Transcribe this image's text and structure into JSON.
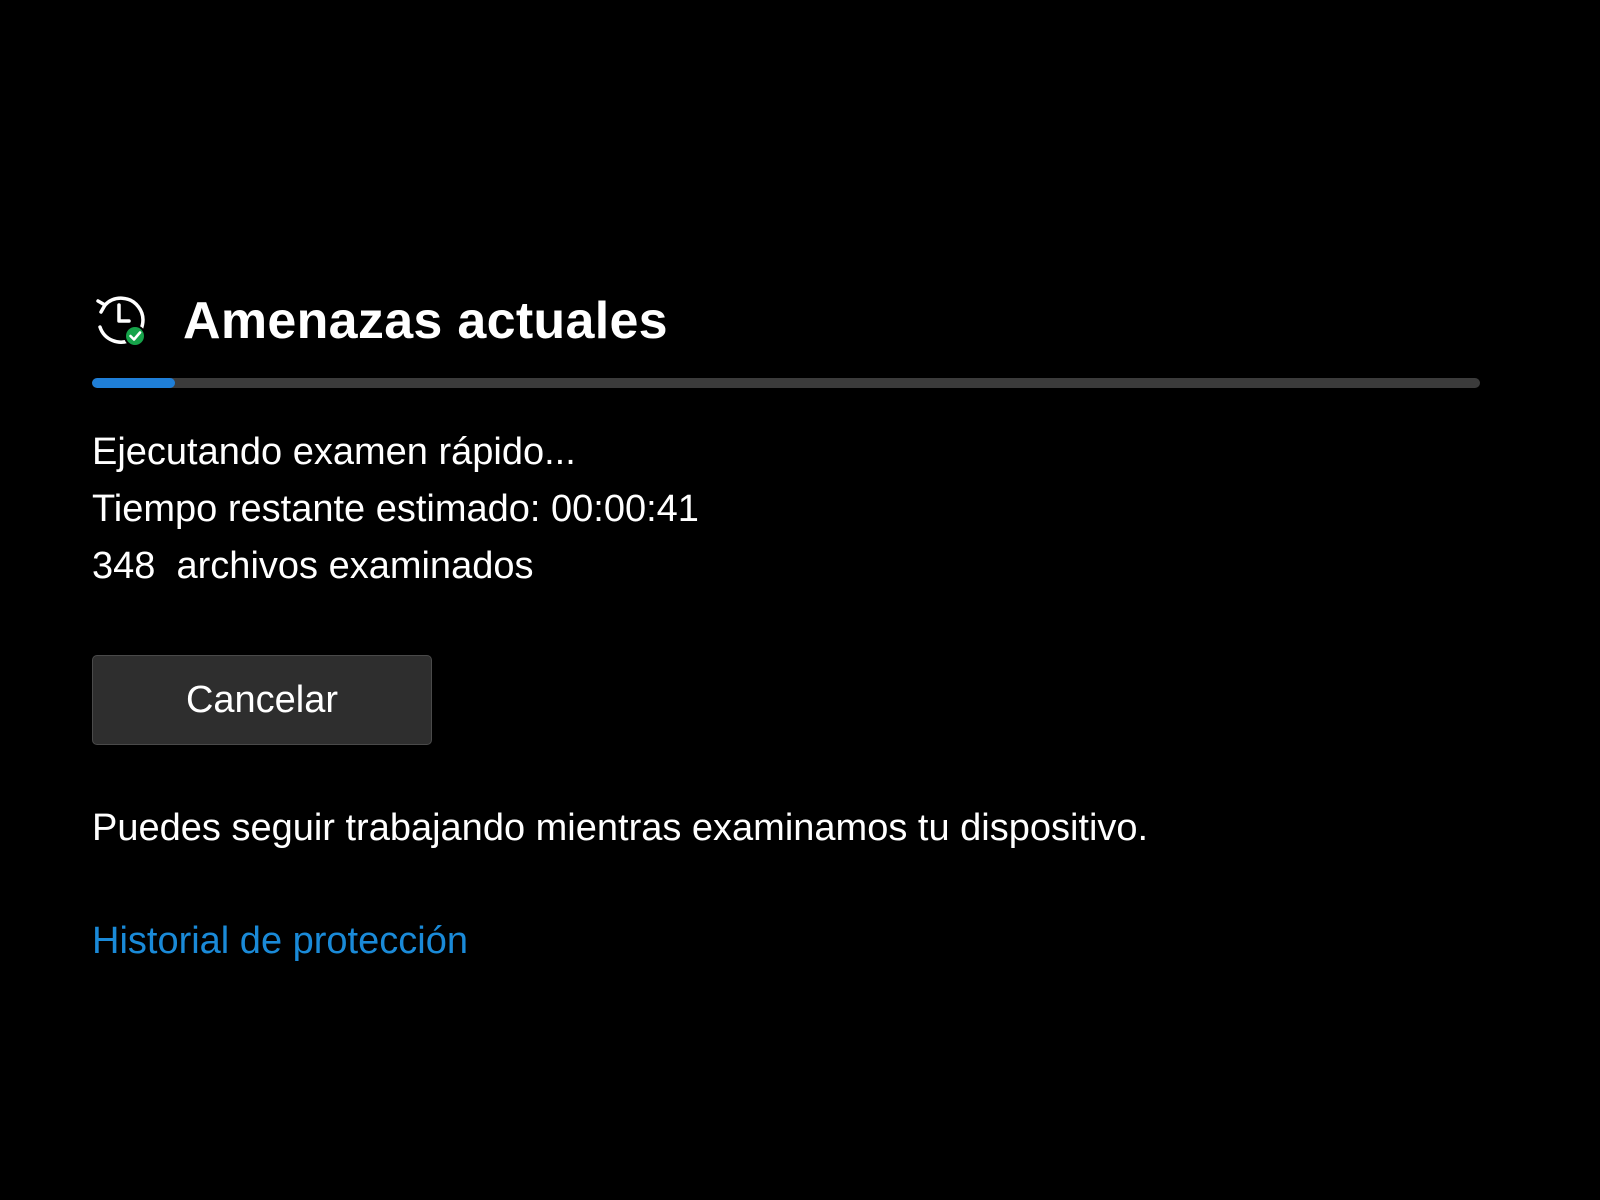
{
  "section": {
    "title": "Amenazas actuales",
    "icon": "clock-history-check-icon"
  },
  "scan": {
    "progress_fraction": 0.06,
    "progress_color": "#1f7fd8",
    "status_line": "Ejecutando examen rápido...",
    "time_remaining": "Tiempo restante estimado: 00:00:41",
    "files_scanned": "348  archivos examinados"
  },
  "actions": {
    "cancel_label": "Cancelar"
  },
  "info_text": "Puedes seguir trabajando mientras examinamos tu dispositivo.",
  "links": {
    "history_label": "Historial de protección",
    "link_color": "#1a8ad8"
  }
}
